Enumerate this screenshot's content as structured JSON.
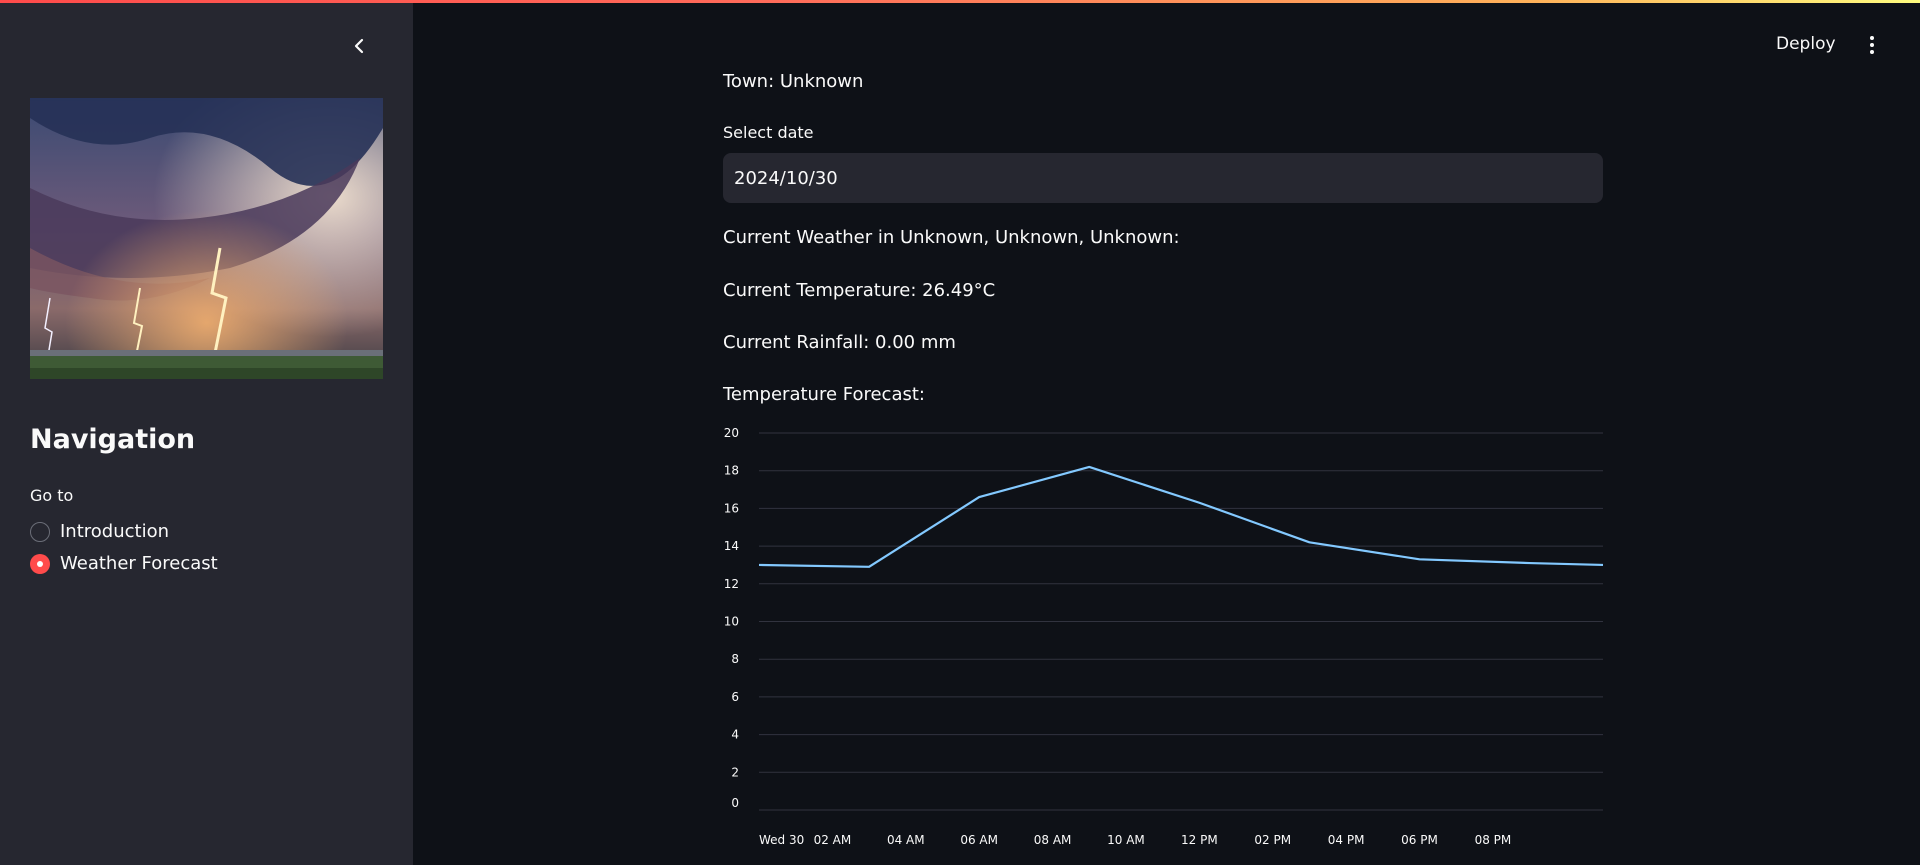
{
  "app": {
    "deploy_label": "Deploy",
    "menu_icon": "more-vertical-icon",
    "accent_color": "#ff4b4b"
  },
  "sidebar": {
    "collapse_icon": "chevron-left-icon",
    "hero_image": "storm-lightning-image",
    "nav_title": "Navigation",
    "goto_label": "Go to",
    "options": [
      {
        "label": "Introduction",
        "selected": false
      },
      {
        "label": "Weather Forecast",
        "selected": true
      }
    ]
  },
  "main": {
    "town": "Town: Unknown",
    "date_label": "Select date",
    "date_value": "2024/10/30",
    "current_weather": "Current Weather in Unknown, Unknown, Unknown:",
    "current_temperature": "Current Temperature: 26.49°C",
    "current_rainfall": "Current Rainfall: 0.00 mm",
    "forecast_heading": "Temperature Forecast:"
  },
  "chart_data": {
    "type": "line",
    "title": "",
    "xlabel": "",
    "ylabel": "",
    "ylim": [
      0,
      20
    ],
    "y_ticks": [
      0,
      2,
      4,
      6,
      8,
      10,
      12,
      14,
      16,
      18,
      20
    ],
    "x_hours_range": [
      0,
      23
    ],
    "x_ticks": [
      {
        "hour": 0,
        "label": "Wed 30"
      },
      {
        "hour": 2,
        "label": "02 AM"
      },
      {
        "hour": 4,
        "label": "04 AM"
      },
      {
        "hour": 6,
        "label": "06 AM"
      },
      {
        "hour": 8,
        "label": "08 AM"
      },
      {
        "hour": 10,
        "label": "10 AM"
      },
      {
        "hour": 12,
        "label": "12 PM"
      },
      {
        "hour": 14,
        "label": "02 PM"
      },
      {
        "hour": 16,
        "label": "04 PM"
      },
      {
        "hour": 18,
        "label": "06 PM"
      },
      {
        "hour": 20,
        "label": "08 PM"
      }
    ],
    "grid": true,
    "series": [
      {
        "color": "#83c9ff",
        "x_hours": [
          0,
          3,
          6,
          9,
          12,
          15,
          18,
          21,
          23
        ],
        "values": [
          13.0,
          12.9,
          16.6,
          18.2,
          16.3,
          14.2,
          13.3,
          13.1,
          13.0
        ]
      }
    ]
  }
}
